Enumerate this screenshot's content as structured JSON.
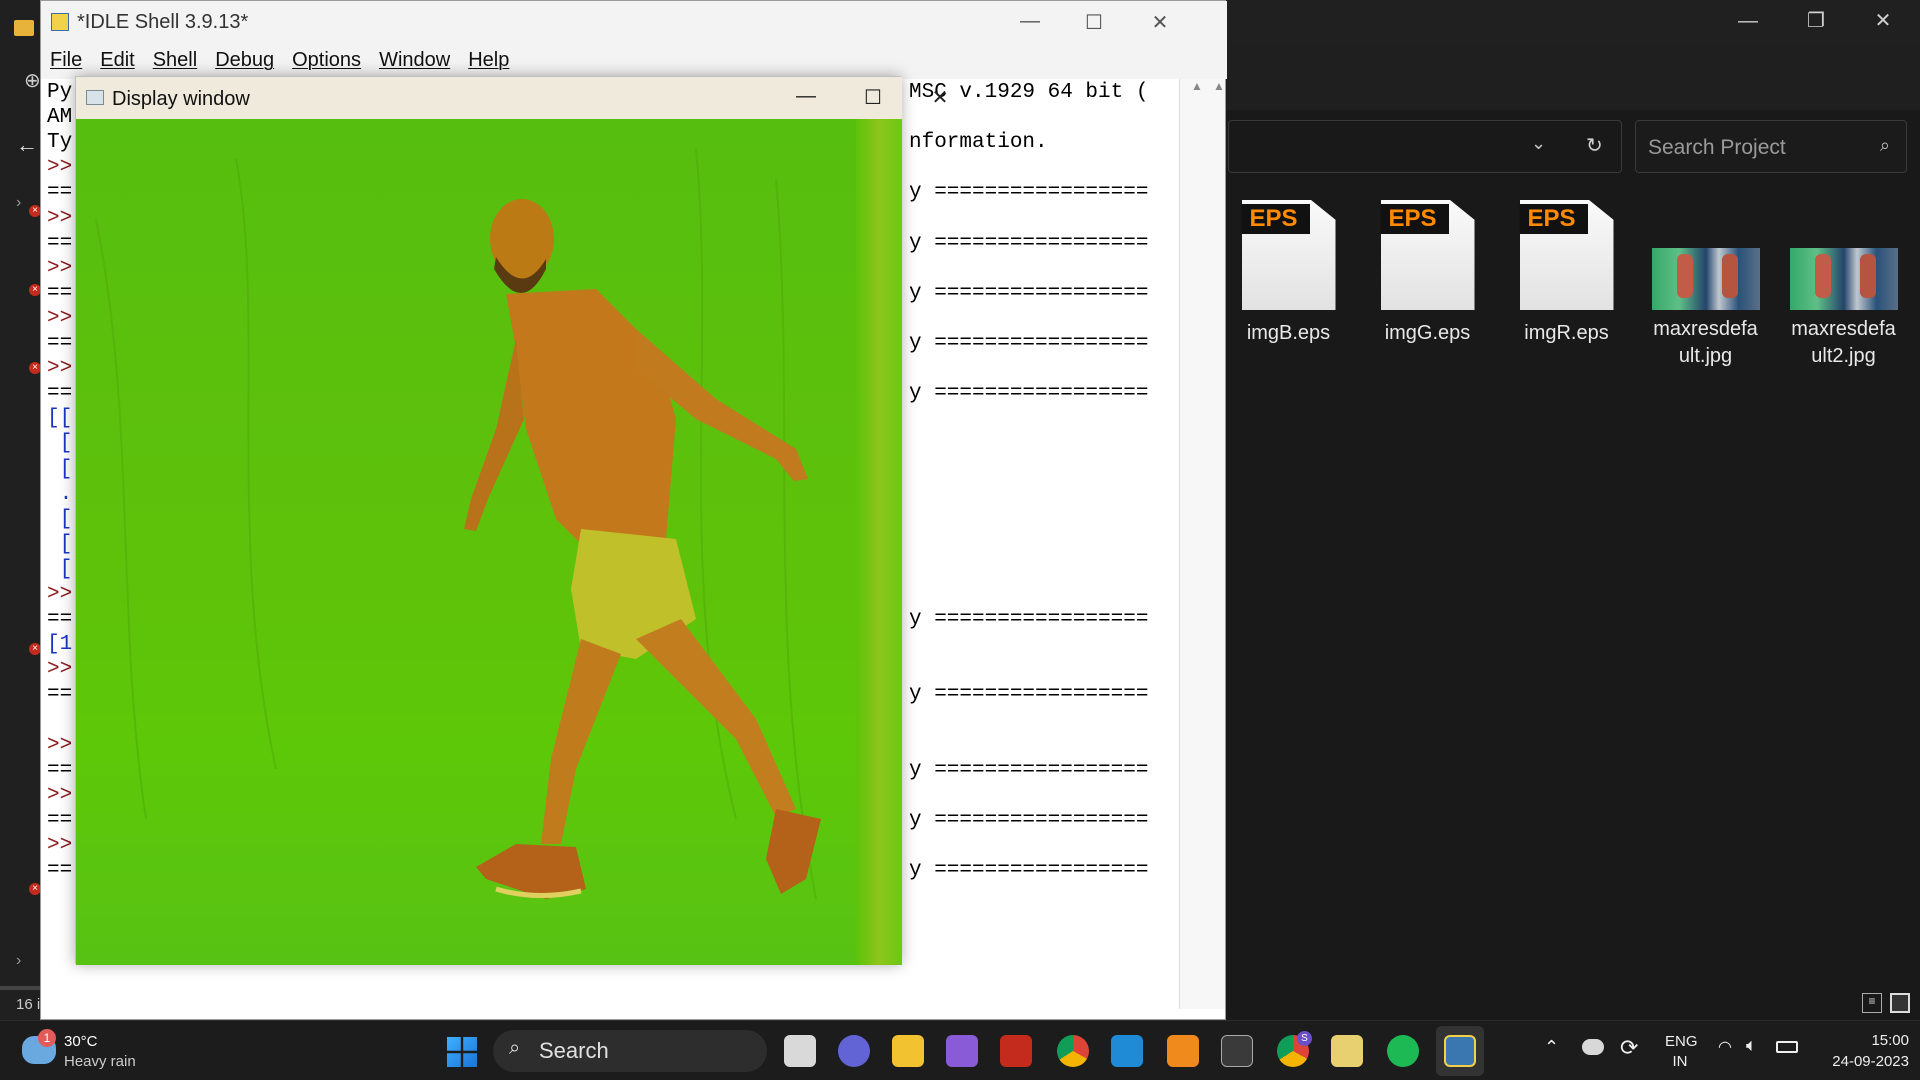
{
  "explorer": {
    "search_placeholder": "Search Project",
    "status_text": "16 i",
    "files": [
      {
        "name": "imgB.eps",
        "type": "eps",
        "badge": "EPS"
      },
      {
        "name": "imgG.eps",
        "type": "eps",
        "badge": "EPS"
      },
      {
        "name": "imgR.eps",
        "type": "eps",
        "badge": "EPS"
      },
      {
        "name": "maxresdefault.jpg",
        "type": "jpg"
      },
      {
        "name": "maxresdefault2.jpg",
        "type": "jpg"
      }
    ]
  },
  "idle": {
    "title": "*IDLE Shell 3.9.13*",
    "menu": [
      "File",
      "Edit",
      "Shell",
      "Debug",
      "Options",
      "Window",
      "Help"
    ],
    "lines": [
      {
        "l": "Py",
        "r": "MSC v.1929 64 bit ("
      },
      {
        "l": "AM",
        "r": ""
      },
      {
        "l": "Ty",
        "r": "nformation."
      },
      {
        "l": ">>",
        "r": ""
      },
      {
        "l": "==",
        "r": "y ================="
      },
      {
        "l": ">>",
        "r": ""
      },
      {
        "l": "==",
        "r": "y ================="
      },
      {
        "l": ">>",
        "r": ""
      },
      {
        "l": "==",
        "r": "y ================="
      },
      {
        "l": ">>",
        "r": ""
      },
      {
        "l": "==",
        "r": "y ================="
      },
      {
        "l": ">>",
        "r": ""
      },
      {
        "l": "==",
        "r": "y ================="
      },
      {
        "l": "[[",
        "r": ""
      },
      {
        "l": " [",
        "r": ""
      },
      {
        "l": " [",
        "r": ""
      },
      {
        "l": " .",
        "r": ""
      },
      {
        "l": " [",
        "r": ""
      },
      {
        "l": " [",
        "r": ""
      },
      {
        "l": " [",
        "r": ""
      },
      {
        "l": ">>",
        "r": ""
      },
      {
        "l": "==",
        "r": "y ================="
      },
      {
        "l": "[1",
        "r": ""
      },
      {
        "l": ">>",
        "r": ""
      },
      {
        "l": "==",
        "r": "y ================="
      },
      {
        "l": "",
        "r": ""
      },
      {
        "l": ">>",
        "r": ""
      },
      {
        "l": "==",
        "r": "y ================="
      },
      {
        "l": ">>",
        "r": ""
      },
      {
        "l": "==",
        "r": "y ================="
      },
      {
        "l": ">>",
        "r": ""
      },
      {
        "l": "==",
        "r": "y ================="
      }
    ]
  },
  "display": {
    "title": "Display window"
  },
  "taskbar": {
    "weather_temp": "30°C",
    "weather_desc": "Heavy rain",
    "weather_badge": "1",
    "search_label": "Search",
    "lang_top": "ENG",
    "lang_bottom": "IN",
    "time": "15:00",
    "date": "24-09-2023",
    "chrome_badge": "S"
  },
  "colors": {
    "green_screen": "#5cc20c",
    "eps_tag": "#ff8a00",
    "prompt": "#8b1a1a"
  }
}
